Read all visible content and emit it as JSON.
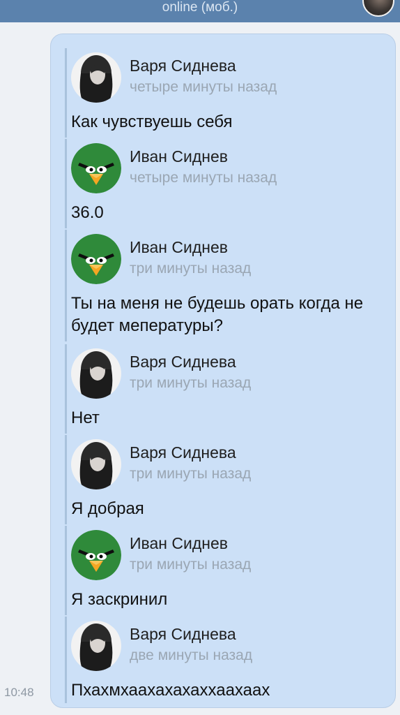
{
  "header": {
    "status": "online (моб.)"
  },
  "message": {
    "time": "10:48",
    "forwarded": [
      {
        "author": "Варя Сиднева",
        "avatar": "girl-photo",
        "time": "четыре минуты назад",
        "text": "Как чувствуешь себя"
      },
      {
        "author": "Иван Сиднев",
        "avatar": "angry-bird-icon",
        "time": "четыре минуты назад",
        "text": "36.0"
      },
      {
        "author": "Иван Сиднев",
        "avatar": "angry-bird-icon",
        "time": "три минуты назад",
        "text": "Ты на меня не будешь орать когда не будет мепературы?"
      },
      {
        "author": "Варя Сиднева",
        "avatar": "girl-photo",
        "time": "три минуты назад",
        "text": "Нет"
      },
      {
        "author": "Варя Сиднева",
        "avatar": "girl-photo",
        "time": "три минуты назад",
        "text": "Я добрая"
      },
      {
        "author": "Иван Сиднев",
        "avatar": "angry-bird-icon",
        "time": "три минуты назад",
        "text": "Я заскринил"
      },
      {
        "author": "Варя Сиднева",
        "avatar": "girl-photo",
        "time": "две минуты назад",
        "text": "Пхахмхаахахахаххаахаах"
      }
    ]
  }
}
